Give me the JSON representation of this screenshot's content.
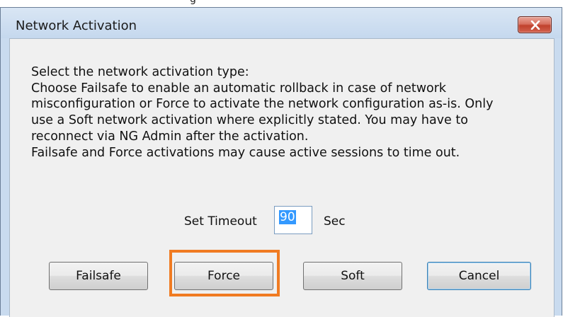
{
  "top_fragment": "g",
  "dialog": {
    "title": "Network Activation",
    "close_icon": "close-x-icon",
    "message_lines": [
      "Select the network activation type:",
      "Choose Failsafe to enable an automatic rollback in case of network",
      "misconfiguration or Force to activate the network configuration as-is. Only",
      "use a Soft network activation where explicitly stated. You may have to",
      "reconnect via NG Admin after the activation.",
      "Failsafe and Force activations may cause active sessions to time out."
    ],
    "timeout": {
      "label": "Set Timeout",
      "value": "90",
      "unit": "Sec"
    },
    "buttons": {
      "failsafe": "Failsafe",
      "force": "Force",
      "soft": "Soft",
      "cancel": "Cancel"
    },
    "highlight_color": "#f07b22"
  }
}
